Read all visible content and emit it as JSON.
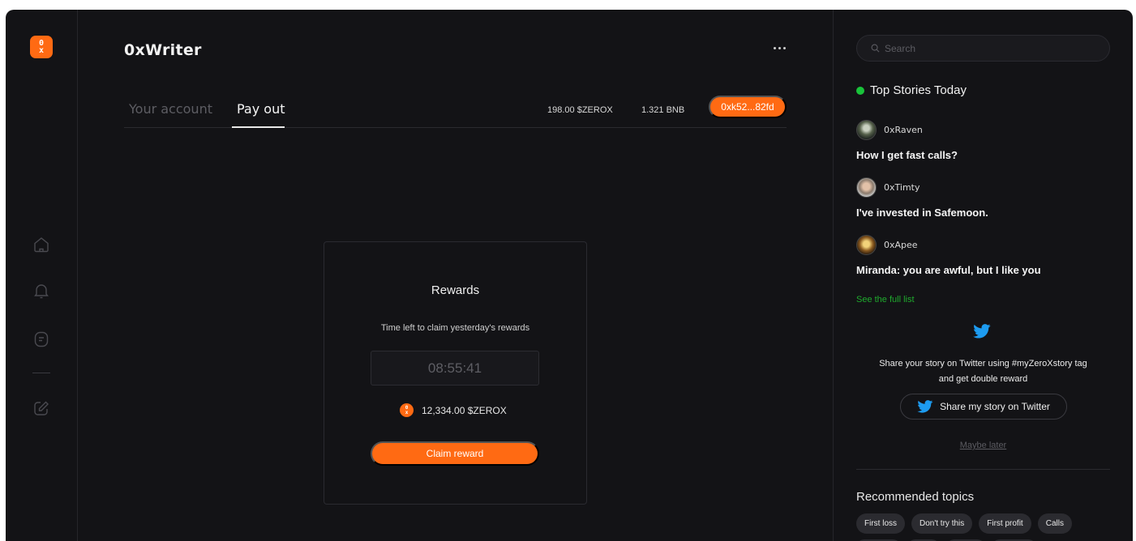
{
  "app": {
    "title": "0xWriter",
    "logo_text_top": "0",
    "logo_text_bottom": "x"
  },
  "tabs": [
    {
      "label": "Your account",
      "active": false
    },
    {
      "label": "Pay out",
      "active": true
    }
  ],
  "balances": {
    "zerox": "198.00 $ZEROX",
    "bnb": "1.321 BNB",
    "wallet": "0xk52...82fd"
  },
  "rewards": {
    "title": "Rewards",
    "subtitle": "Time left to claim yesterday's rewards",
    "timer": "08:55:41",
    "amount": "12,334.00 $ZEROX",
    "claim_label": "Claim reward"
  },
  "sidebar_right": {
    "search_placeholder": "Search",
    "stories_heading": "Top Stories Today",
    "stories": [
      {
        "author": "0xRaven",
        "title": "How I get fast calls?"
      },
      {
        "author": "0xTimty",
        "title": "I've invested in Safemoon."
      },
      {
        "author": "0xApee",
        "title": "Miranda: you are awful, but I like you"
      }
    ],
    "full_list_label": "See the full list",
    "share_line1": "Share your story on Twitter using #myZeroXstory tag",
    "share_line2": "and get double reward",
    "share_button_label": "Share my story on Twitter",
    "maybe_later_label": "Maybe later",
    "topics_heading": "Recommended topics",
    "topics": [
      "First loss",
      "Don't try this",
      "First profit",
      "Calls"
    ]
  },
  "colors": {
    "accent": "#ff6a13",
    "background": "#131316",
    "live": "#19c33a",
    "link_green": "#1faa2d",
    "twitter": "#1d9bf0"
  },
  "icons": [
    "home-icon",
    "bell-icon",
    "wallet-icon",
    "edit-icon",
    "search-icon",
    "twitter-icon",
    "more-dots-icon"
  ]
}
